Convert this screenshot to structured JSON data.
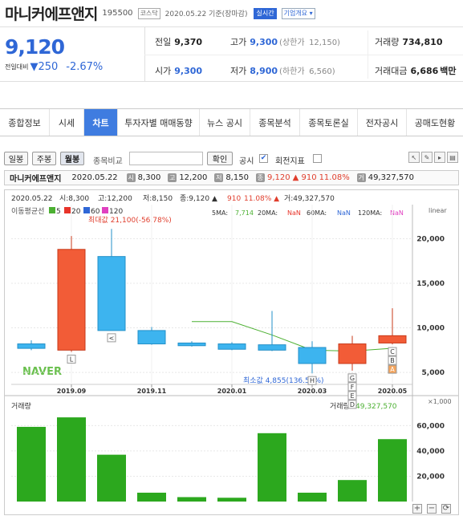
{
  "header": {
    "name": "마니커에프앤지",
    "code": "195500",
    "market": "코스닥",
    "date_time": "2020.05.22 기준(장마감)",
    "realtime_label": "실시간",
    "company_info_label": "기업개요"
  },
  "price": {
    "current": "9,120",
    "change_label": "전일대비",
    "change_value": "250",
    "change_percent": "-2.67%",
    "colors": {
      "down": "#2f67d6",
      "up": "#e03e2d"
    }
  },
  "stats": {
    "prev_close": {
      "label": "전일",
      "value": "9,370"
    },
    "high": {
      "label": "고가",
      "value": "9,300",
      "sub_label": "(상한가",
      "sub_value": "12,150)"
    },
    "volume": {
      "label": "거래량",
      "value": "734,810"
    },
    "open": {
      "label": "시가",
      "value": "9,300"
    },
    "low": {
      "label": "저가",
      "value": "8,900",
      "sub_label": "(하한가",
      "sub_value": "6,560)"
    },
    "amount": {
      "label": "거래대금",
      "value": "6,686",
      "unit": "백만"
    }
  },
  "tabs": [
    "종합정보",
    "시세",
    "차트",
    "투자자별 매매동향",
    "뉴스 공시",
    "종목분석",
    "종목토론실",
    "전자공시",
    "공매도현황"
  ],
  "active_tab": "차트",
  "toolbar": {
    "periods": [
      "일봉",
      "주봉",
      "월봉"
    ],
    "active_period": "월봉",
    "compare_label": "종목비교",
    "compare_placeholder": "",
    "confirm_label": "확인",
    "notice_label": "공시",
    "notice_checked": "✔",
    "volume_label": "회전지표"
  },
  "infobar": {
    "date": "2020.05.22",
    "open_badge": "시",
    "open": "8,300",
    "high_badge": "고",
    "high": "12,200",
    "low_badge": "저",
    "low": "8,150",
    "close_badge": "종",
    "close": "9,120",
    "change": "▲ 910",
    "change_pct": "11.08%",
    "vol_badge": "거",
    "volume": "49,327,570"
  },
  "chart_data": {
    "type": "candlestick",
    "title_line": {
      "date": "2020.05.22",
      "open": "시:8,300",
      "high": "고:12,200",
      "low": "저:8,150",
      "close": "종:9,120 ▲",
      "change": "910",
      "pct": "11.08% ▲",
      "volume": "거:49,327,570"
    },
    "legend_label": "이동평균선",
    "ma_legend": [
      {
        "name": "5",
        "color": "#4cb032"
      },
      {
        "name": "20",
        "color": "#e8342a"
      },
      {
        "name": "60",
        "color": "#2f67d6"
      },
      {
        "name": "120",
        "color": "#e040c0"
      }
    ],
    "ma_values": [
      {
        "label": "5MA:",
        "value": "7,714",
        "color": "#4cb032"
      },
      {
        "label": "20MA:",
        "value": "NaN",
        "color": "#e8342a"
      },
      {
        "label": "60MA:",
        "value": "NaN",
        "color": "#2f67d6"
      },
      {
        "label": "120MA:",
        "value": "NaN",
        "color": "#e040c0"
      }
    ],
    "scale_label": "linear",
    "x_labels": [
      "2019.09",
      "2019.11",
      "2020.01",
      "2020.03",
      "2020.05"
    ],
    "x_label_index": [
      1,
      3,
      5,
      7,
      9
    ],
    "y_ticks": [
      5000,
      10000,
      15000,
      20000
    ],
    "ylim": [
      4200,
      22200
    ],
    "candles": [
      {
        "o": 8200,
        "h": 8600,
        "l": 7500,
        "c": 7700
      },
      {
        "o": 7500,
        "h": 20300,
        "l": 7300,
        "c": 18800
      },
      {
        "o": 18000,
        "h": 21100,
        "l": 9700,
        "c": 9700
      },
      {
        "o": 9700,
        "h": 10100,
        "l": 8100,
        "c": 8200
      },
      {
        "o": 8300,
        "h": 8500,
        "l": 7900,
        "c": 8000
      },
      {
        "o": 8200,
        "h": 8400,
        "l": 7500,
        "c": 7600
      },
      {
        "o": 8100,
        "h": 11900,
        "l": 7400,
        "c": 7500
      },
      {
        "o": 7800,
        "h": 8500,
        "l": 4900,
        "c": 6000
      },
      {
        "o": 6000,
        "h": 9100,
        "l": 5200,
        "c": 8200
      },
      {
        "o": 8300,
        "h": 12200,
        "l": 8150,
        "c": 9120
      }
    ],
    "ma5": [
      null,
      null,
      null,
      null,
      10700,
      10700,
      9200,
      7500,
      7400,
      7714
    ],
    "max_label": "최대값 21,100(-56.78%)",
    "min_label": "최소값 4,855(136.53%)",
    "markers": [
      {
        "i": 1,
        "text": "L"
      },
      {
        "i": 2,
        "text": "<"
      },
      {
        "i": 7,
        "text": "H"
      },
      {
        "i": 8,
        "text": "G"
      },
      {
        "i": 8,
        "text": "F"
      },
      {
        "i": 8,
        "text": "E"
      },
      {
        "i": 8,
        "text": "D"
      },
      {
        "i": 9,
        "text": "C"
      },
      {
        "i": 9,
        "text": "B"
      },
      {
        "i": 9,
        "text": "A"
      }
    ],
    "volume_panel": {
      "label": "거래량",
      "current_label": "거래량:",
      "current_value": "49,327,570",
      "unit_label": "×1,000",
      "y_ticks": [
        20000,
        40000,
        60000
      ],
      "ylim": [
        0,
        71000
      ],
      "values": [
        59000,
        66500,
        37000,
        7000,
        3500,
        3000,
        54000,
        7000,
        17000,
        49300
      ]
    },
    "watermark": "NAVER"
  }
}
